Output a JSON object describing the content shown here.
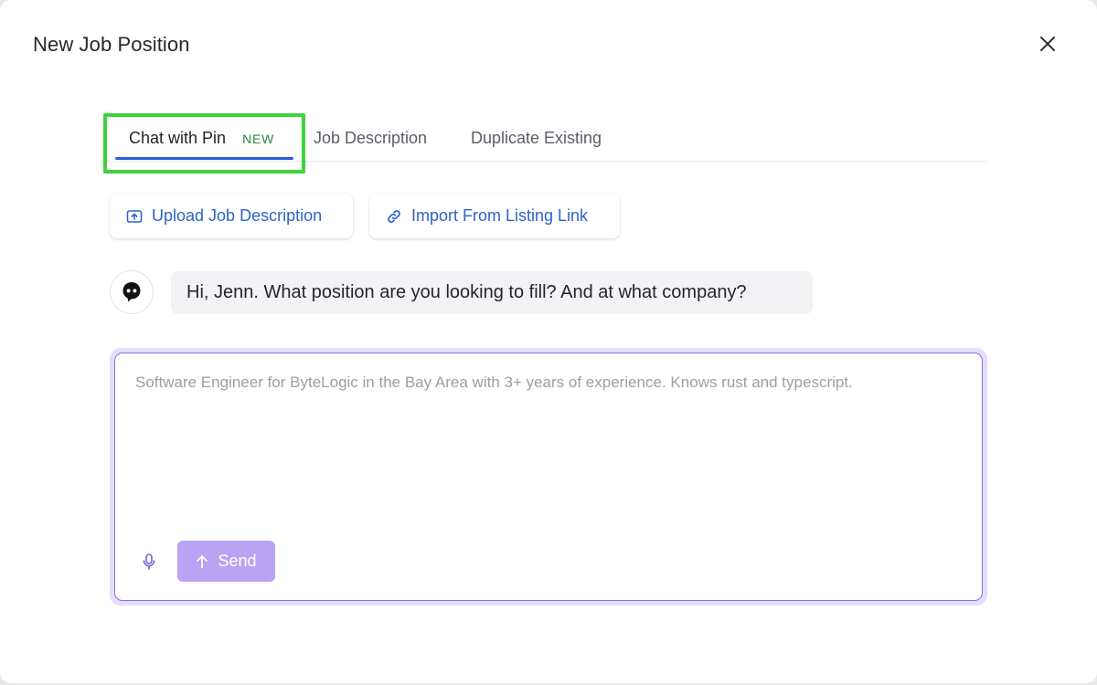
{
  "modal": {
    "title": "New Job Position"
  },
  "tabs": [
    {
      "label": "Chat with Pin",
      "badge": "NEW",
      "active": true
    },
    {
      "label": "Job Description",
      "active": false
    },
    {
      "label": "Duplicate Existing",
      "active": false
    }
  ],
  "actions": {
    "upload_label": "Upload Job Description",
    "import_label": "Import From Listing Link"
  },
  "chat": {
    "assistant_message": "Hi, Jenn. What position are you looking to fill? And at what company?"
  },
  "composer": {
    "value": "",
    "placeholder": "Software Engineer for ByteLogic in the Bay Area with 3+ years of experience. Knows rust and typescript.",
    "send_label": "Send"
  },
  "icons": {
    "close": "close-icon",
    "upload": "upload-icon",
    "link": "link-icon",
    "avatar": "pin-bot-icon",
    "mic": "microphone-icon",
    "send_arrow": "arrow-up-icon"
  },
  "colors": {
    "accent_blue": "#2d63c8",
    "tab_underline": "#2f5bd6",
    "badge_green": "#2b8a3e",
    "highlight_green": "#3ed23e",
    "composer_border": "#8a6ee0",
    "send_button": "#b9a3f3"
  }
}
